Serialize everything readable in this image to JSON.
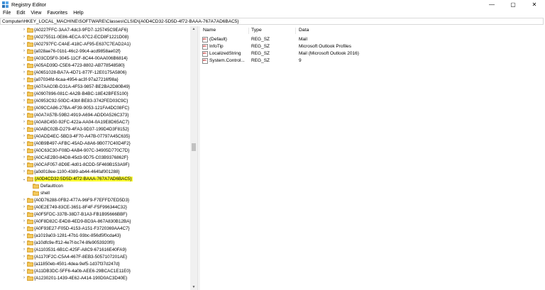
{
  "window": {
    "title": "Registry Editor",
    "controls": {
      "minimize": "—",
      "maximize": "▢",
      "close": "✕"
    }
  },
  "menu": [
    "File",
    "Edit",
    "View",
    "Favorites",
    "Help"
  ],
  "address": "Computer\\HKEY_LOCAL_MACHINE\\SOFTWARE\\Classes\\CLSID\\{A0D4CD32-5D5D-4f72-BAAA-767A7AD6BAC5}",
  "tree": [
    "{A0227FFC-3AA7-4dc3-9FD7-125745C9EAF6}",
    "{A0275511-0E86-4ECA-97C2-ECD8F1221D08}",
    "{A02797FC-C4AE-418C-AF95-E637C7EAD2A1}",
    "{a028ae76-01b1-46c2-99c4-acd9858ae02f}",
    "{A03CD5F0-3045-11CF-8C44-00AA006B6814}",
    "{A05AD39D-C5E6-4723-8802-AB778548580}",
    "{A0651028-BA7A-4D71-877F-12E0175A5806}",
    "{a07034fd-6caa-4954-ac3f-97a27216f98a}",
    "{A07AAC0B-D31A-4F53-9857-BE2BA2D80B49}",
    "{A0907896-081C-4A2B-B4BC-18E42BFE5100}",
    "{A0953C92-50DC-43bf-BE83-3742FED03C9C}",
    "{A09CCA86-27BA-4F39-9053-121FA4DC08FC}",
    "{A0A7A57B-59B2-4919-A694-ADD0A526C373}",
    "{A0A8C450-92FC-422a-AA04-0A19E8D65AC7}",
    "{A0ABC02B-D279-4FA3-9D37-199D4D3F8152}",
    "{A0ADD4EC-5BD3-4F70-A47B-07797A45C635}",
    "{A0B9B497-AFBC-45AD-A8A6-9B077C40D4F2}",
    "{A0C63C30-F08D-4AB4-907C-34905D770C7D}",
    "{A0CAE2B0-84D8-45d3-9D75-C03B9376862F}",
    "{A0CAF057-8D9E-4d01-8CDD-5F469B153A9F}",
    "{a0d018ee-1100-4389-ab44-464faf001288}",
    "{A0D4CD32-5D5D-4f72-BAAA-767A7AD6BAC5}",
    "DefaultIcon",
    "shell",
    "{A0D76288-0FB2-477A-96F9-F7EFFD7ED5D3}",
    "{A0E2E749-83CE-3651-8F4F-F5F996344C32}",
    "{A0F5FDC-337B-38D7-B1A3-FB1B95666BBF}",
    "{A0F8D82C-E4D8-4ED9-BD3A-867A830B12BA}",
    "{A0F93E27-F05D-4153-A151-F3720369AA4C7}",
    "{a1019a03-1281-47b1-93bc-856d5f0cda43}",
    "{a10dfc9e-ff12-4e7f-bc74-8fe9053920f0}",
    "{A1103531-6B1C-425F-A8C9-671616E40FA9}",
    "{A1170F2C-C5A4-467F-8EB3-5057107201AE}",
    "{a11850eb-4501-4dea-9ef5-1d37f37d247d}",
    "{A11DB3DC-5FF6-4a0b-AEE6-29BCAC1E11E0}",
    "{A1230201-1439-4E62-A414-190D0AC3D40E}"
  ],
  "columns": {
    "name": "Name",
    "type": "Type",
    "data": "Data"
  },
  "values": [
    {
      "name": "(Default)",
      "type": "REG_SZ",
      "data": "Mail"
    },
    {
      "name": "InfoTip",
      "type": "REG_SZ",
      "data": "Microsoft Outlook Profiles"
    },
    {
      "name": "LocalizedString",
      "type": "REG_SZ",
      "data": "Mail (Microsoft Outlook 2016)"
    },
    {
      "name": "System.Control...",
      "type": "REG_SZ",
      "data": "9"
    }
  ],
  "value_icon_text": "ab",
  "scroll": {
    "up": "▲",
    "down": "▼"
  },
  "colors": {
    "highlight": "#ffff33",
    "folder": "#f3c95b"
  }
}
